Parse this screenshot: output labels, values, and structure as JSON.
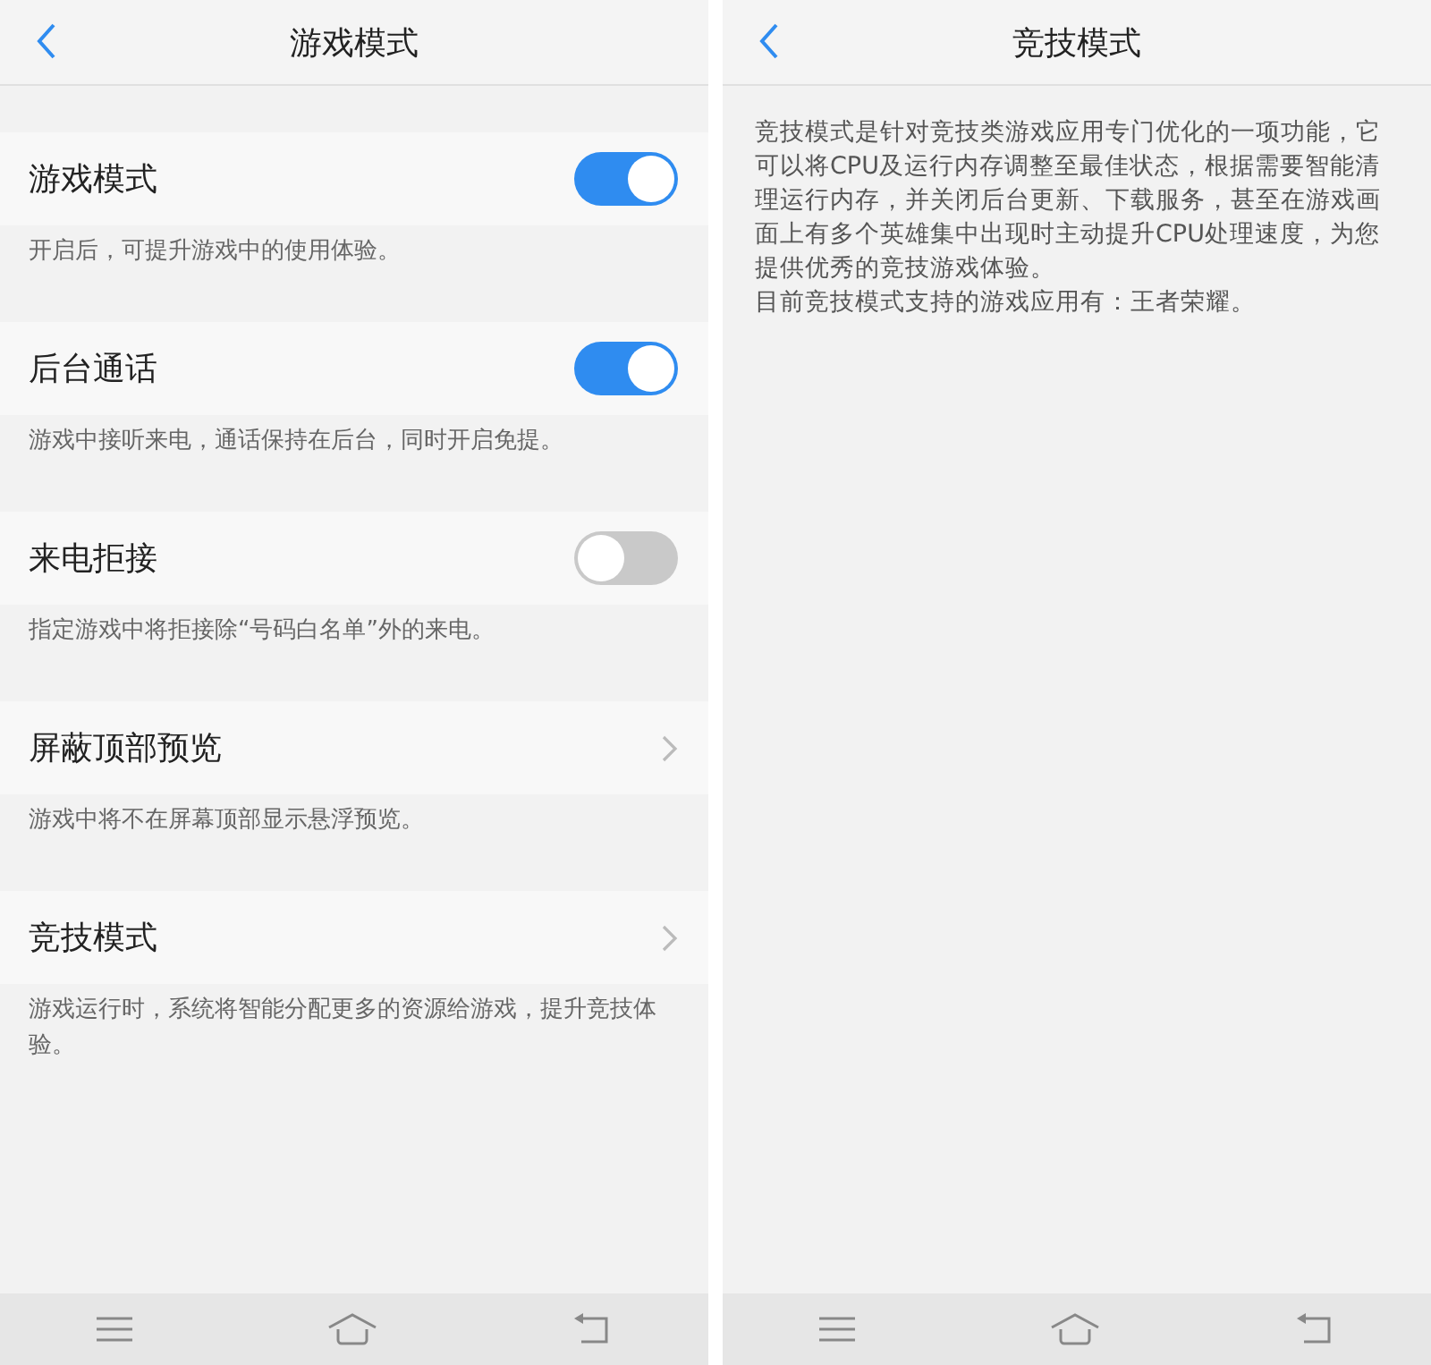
{
  "screens": [
    {
      "title": "游戏模式",
      "settings": [
        {
          "label": "游戏模式",
          "kind": "toggle",
          "on": true,
          "description": "开启后，可提升游戏中的使用体验。"
        },
        {
          "label": "后台通话",
          "kind": "toggle",
          "on": true,
          "description": "游戏中接听来电，通话保持在后台，同时开启免提。"
        },
        {
          "label": "来电拒接",
          "kind": "toggle",
          "on": false,
          "description": "指定游戏中将拒接除“号码白名单”外的来电。"
        },
        {
          "label": "屏蔽顶部预览",
          "kind": "link",
          "description": "游戏中将不在屏幕顶部显示悬浮预览。"
        },
        {
          "label": "竞技模式",
          "kind": "link",
          "description": "游戏运行时，系统将智能分配更多的资源给游戏，提升竞技体验。"
        }
      ]
    },
    {
      "title": "竞技模式",
      "paragraphs": [
        "竞技模式是针对竞技类游戏应用专门优化的一项功能，它可以将CPU及运行内存调整至最佳状态，根据需要智能清理运行内存，并关闭后台更新、下载服务，甚至在游戏画面上有多个英雄集中出现时主动提升CPU处理速度，为您提供优秀的竞技游戏体验。",
        "目前竞技模式支持的游戏应用有：王者荣耀。"
      ]
    }
  ]
}
